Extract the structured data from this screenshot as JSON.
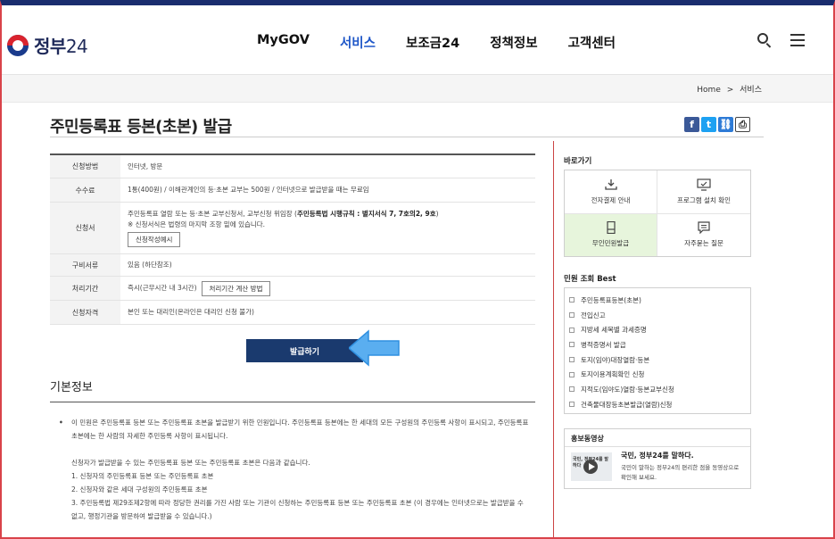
{
  "header": {
    "logo": {
      "text": "정부",
      "num": "24"
    },
    "nav": [
      "MyGOV",
      "서비스",
      "보조금24",
      "정책정보",
      "고객센터"
    ],
    "active_nav": "서비스"
  },
  "breadcrumb": {
    "home": "Home",
    "sep": ">",
    "current": "서비스"
  },
  "page": {
    "title": "주민등록표 등본(초본) 발급",
    "share": {
      "fb": "f",
      "tw": "t",
      "link": "⛓",
      "print": "⎙"
    }
  },
  "info": {
    "rows": [
      {
        "label": "신청방법",
        "value": "인터넷, 방문"
      },
      {
        "label": "수수료",
        "value": "1통(400원) / 이해관계인의 등·초본 교부는 500원 / 인터넷으로 발급받을 때는 무료임"
      },
      {
        "label": "신청서",
        "value_pre": "주민등록표 열람 또는 등·초본 교부신청서, 교부신청 위임장 (",
        "value_bold": "주민등록법 시행규칙 : 별지서식 7, 7호의2, 9호",
        "value_post": ")",
        "note": "※ 신청서식은 법령의 마지막 조항 밑에 있습니다.",
        "button": "신청작성예시"
      },
      {
        "label": "구비서류",
        "value": "있음 (하단참조)"
      },
      {
        "label": "처리기간",
        "value": "즉시(근무시간 내 3시간)",
        "button": "처리기간 계산 방법"
      },
      {
        "label": "신청자격",
        "value": "본인 또는 대리인(온라인은 대리인 신청 불가)"
      }
    ]
  },
  "issue_button": "발급하기",
  "basic_info": {
    "title": "기본정보",
    "bullet": "•",
    "lead": "이 민원은 주민등록표 등본 또는 주민등록표 초본을 발급받기 위한 민원입니다. 주민등록표 등본에는 한 세대의 모든 구성원의 주민등록 사항이 표시되고, 주민등록표 초본에는 한 사람의 자세한 주민등록 사항이 표시됩니다.",
    "sub_intro": "신청자가 발급받을 수 있는 주민등록표 등본 또는 주민등록표 초본은 다음과 같습니다.",
    "items": [
      "1. 신청자의 주민등록표 등본 또는 주민등록표 초본",
      "2. 신청자와 같은 세대 구성원의 주민등록표 초본",
      "3. 주민등록법 제29조제2항에 따라 정당한 권리를 가진 사람 또는 기관이 신청하는 주민등록표 등본 또는 주민등록표 초본 (이 경우에는 인터넷으로는 발급받을 수 없고, 행정기관을 방문하여 발급받을 수 있습니다.)"
    ]
  },
  "sidebar": {
    "shortcut_title": "바로가기",
    "shortcuts": [
      {
        "label": "전자결제 안내",
        "icon": "payment-icon"
      },
      {
        "label": "프로그램 설치 확인",
        "icon": "monitor-icon"
      },
      {
        "label": "무인민원발급",
        "icon": "kiosk-icon"
      },
      {
        "label": "자주묻는 질문",
        "icon": "faq-icon"
      }
    ],
    "best_title": "민원 조회 Best",
    "best": [
      "주민등록표등본(초본)",
      "전입신고",
      "지방세 세목별 과세증명",
      "병적증명서 발급",
      "토지(임야)대장열람·등본",
      "토지이용계획확인 신청",
      "지적도(임야도)열람·등본교부신청",
      "건축물대장등초본발급(열람)신청"
    ],
    "promo_title": "홍보동영상",
    "promo_heading": "국민, 정부24를 말하다.",
    "promo_body": "국민이 말하는 정부24의 편리한 점을 동영상으로 확인해 보세요.",
    "thumb_text": "국민, 정부24를 말하다"
  }
}
